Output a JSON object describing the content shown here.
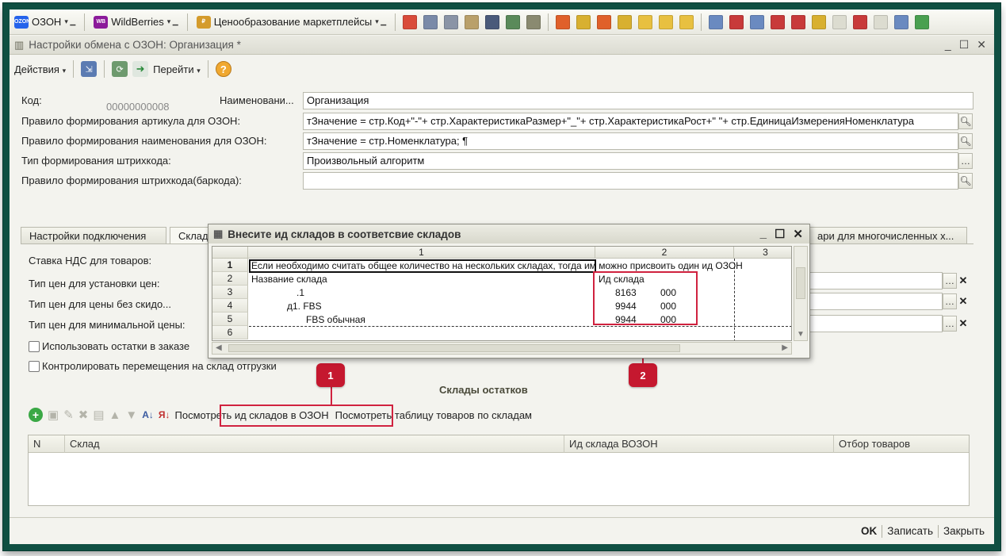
{
  "toolbar": {
    "ozon_label": "ОЗОН",
    "wb_label": "WildBerries",
    "pricing_label": "Ценообразование маркетплейсы"
  },
  "window": {
    "title": "Настройки обмена с ОЗОН: Организация *"
  },
  "actions": {
    "actions_label": "Действия",
    "goto_label": "Перейти",
    "help_label": "?"
  },
  "form": {
    "code_label": "Код:",
    "code_value": "00000000008",
    "name_label": "Наименовани...",
    "name_value": "Организация",
    "article_rule_label": "Правило формирования артикула для ОЗОН:",
    "article_rule_value": "тЗначение =  стр.Код+\"-\"+ стр.ХарактеристикаРазмер+\"_\"+  стр.ХарактеристикаРост+\" \"+ стр.ЕдиницаИзмеренияНоменклатура",
    "name_rule_label": "Правило формирования наименования для ОЗОН:",
    "name_rule_value": "тЗначение =  стр.Номенклатура; ¶",
    "barcode_type_label": "Тип формирования штрихкода:",
    "barcode_type_value": "Произвольный алгоритм",
    "barcode_rule_label": "Правило формирования штрихкода(баркода):",
    "barcode_rule_value": ""
  },
  "tabs": [
    {
      "label": "Настройки подключения"
    },
    {
      "label": "Склад"
    },
    {
      "label": "ари для многочисленных х..."
    }
  ],
  "panel": {
    "vat_label": "Ставка НДС для товаров:",
    "price_type_label": "Тип цен для установки цен:",
    "price_nodisc_label": "Тип цен для цены без скидо...",
    "price_min_label": "Тип цен для минимальной цены:",
    "use_stock_label": "Использовать остатки в заказе",
    "control_move_label": "Контролировать перемещения на склад отгрузки",
    "warehouses_title": "Склады остатков",
    "view_ids_button": "Посмотреть ид складов в ОЗОН",
    "view_table_button": "Посмотреть таблицу товаров по складам"
  },
  "wh_table": {
    "columns": [
      "N",
      "Склад",
      "Ид склада ВОЗОН",
      "Отбор товаров"
    ]
  },
  "bottom": {
    "ok": "OK",
    "save": "Записать",
    "close": "Закрыть"
  },
  "popup": {
    "title": "Внесите ид складов в соответсвие складов",
    "col_heads": [
      "1",
      "2",
      "3"
    ],
    "row_nums": [
      "1",
      "2",
      "3",
      "4",
      "5",
      "6"
    ],
    "row1": "Если необходимо считать общее количество на нескольких складах, тогда им можно присвоить один ид ОЗОН",
    "row2_name": "Название склада",
    "row2_id": "Ид склада",
    "row3_name": ".1",
    "row3_id_a": "8163",
    "row3_id_b": "000",
    "row4_name": "д1. FBS",
    "row4_id_a": "9944",
    "row4_id_b": "000",
    "row5_name": "FBS обычная",
    "row5_id_a": "9944",
    "row5_id_b": "000"
  },
  "callouts": {
    "one": "1",
    "two": "2"
  }
}
